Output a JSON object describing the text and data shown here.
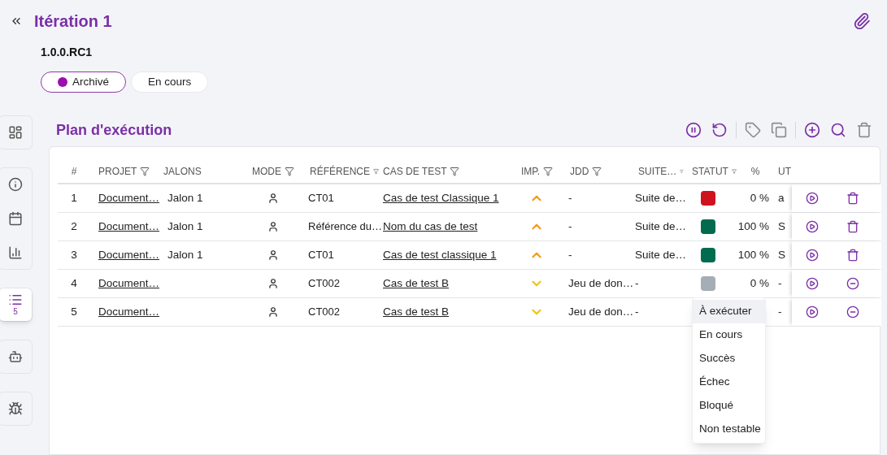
{
  "header": {
    "title": "Itération 1",
    "version": "1.0.0.RC1",
    "status_pills": [
      {
        "label": "Archivé",
        "selected": true
      },
      {
        "label": "En cours",
        "selected": false
      }
    ]
  },
  "sidebar": {
    "groups": [
      [
        {
          "kind": "dashboard",
          "selected": false
        }
      ],
      [
        {
          "kind": "info",
          "selected": false
        },
        {
          "kind": "calendar",
          "selected": false
        },
        {
          "kind": "chart",
          "selected": false
        }
      ],
      [
        {
          "kind": "list",
          "selected": true,
          "count": "5"
        }
      ],
      [
        {
          "kind": "robot",
          "selected": false
        }
      ],
      [
        {
          "kind": "bug",
          "selected": false
        }
      ]
    ]
  },
  "plan": {
    "title": "Plan d'exécution",
    "toolbar": [
      [
        {
          "kind": "pause",
          "disabled": false
        },
        {
          "kind": "replay",
          "disabled": false
        }
      ],
      [
        {
          "kind": "tag",
          "disabled": true
        },
        {
          "kind": "copy",
          "disabled": true
        }
      ],
      [
        {
          "kind": "add",
          "disabled": false
        },
        {
          "kind": "search",
          "disabled": false
        },
        {
          "kind": "delete",
          "disabled": true
        }
      ]
    ],
    "table": {
      "columns": [
        {
          "label": "#",
          "filter": false
        },
        {
          "label": "PROJET",
          "filter": true
        },
        {
          "label": "JALONS",
          "filter": false
        },
        {
          "label": "MODE",
          "filter": true
        },
        {
          "label": "RÉFÉRENCE",
          "filter": true
        },
        {
          "label": "CAS DE TEST",
          "filter": true
        },
        {
          "label": "IMP.",
          "filter": true
        },
        {
          "label": "JDD",
          "filter": true
        },
        {
          "label": "SUITE…",
          "filter": true
        },
        {
          "label": "STATUT",
          "filter": true
        },
        {
          "label": "%",
          "filter": false
        },
        {
          "label": "UT",
          "filter": false
        }
      ],
      "rows": [
        {
          "number": "1",
          "project": "Document…",
          "milestone": "Jalon 1",
          "mode": {
            "kind": "manual"
          },
          "reference": "CT01",
          "test_case": "Cas de test Classique 1",
          "importance": {
            "kind": "high"
          },
          "dataset": "-",
          "suite": "Suite de…",
          "status": {
            "color": "#d0121f"
          },
          "percent": "0 %",
          "user": "a",
          "action": {
            "kind": "delete"
          }
        },
        {
          "number": "2",
          "project": "Document…",
          "milestone": "Jalon 1",
          "mode": {
            "kind": "manual"
          },
          "reference": "Référence du…",
          "test_case": "Nom du cas de test",
          "importance": {
            "kind": "high"
          },
          "dataset": "-",
          "suite": "Suite de…",
          "status": {
            "color": "#006b4f"
          },
          "percent": "100 %",
          "user": "S",
          "action": {
            "kind": "delete"
          }
        },
        {
          "number": "3",
          "project": "Document…",
          "milestone": "Jalon 1",
          "mode": {
            "kind": "manual"
          },
          "reference": "CT01",
          "test_case": "Cas de test classique 1",
          "importance": {
            "kind": "high"
          },
          "dataset": "-",
          "suite": "Suite de…",
          "status": {
            "color": "#006b4f"
          },
          "percent": "100 %",
          "user": "S",
          "action": {
            "kind": "delete"
          }
        },
        {
          "number": "4",
          "project": "Document…",
          "mode": {
            "kind": "manual"
          },
          "reference": "CT002",
          "test_case": "Cas de test B",
          "importance": {
            "kind": "low"
          },
          "dataset": "Jeu de don…",
          "suite": "-",
          "status": {
            "color": "#a5adb5"
          },
          "percent": "0 %",
          "user": "-",
          "action": {
            "kind": "remove"
          }
        },
        {
          "number": "5",
          "project": "Document…",
          "mode": {
            "kind": "manual"
          },
          "reference": "CT002",
          "test_case": "Cas de test B",
          "importance": {
            "kind": "low"
          },
          "dataset": "Jeu de don…",
          "suite": "-",
          "user": "-",
          "action": {
            "kind": "remove"
          }
        }
      ]
    },
    "status_menu": {
      "items": [
        {
          "label": "À exécuter",
          "selected": true
        },
        {
          "label": "En cours",
          "selected": false
        },
        {
          "label": "Succès",
          "selected": false
        },
        {
          "label": "Échec",
          "selected": false
        },
        {
          "label": "Bloqué",
          "selected": false
        },
        {
          "label": "Non testable",
          "selected": false
        }
      ]
    }
  }
}
